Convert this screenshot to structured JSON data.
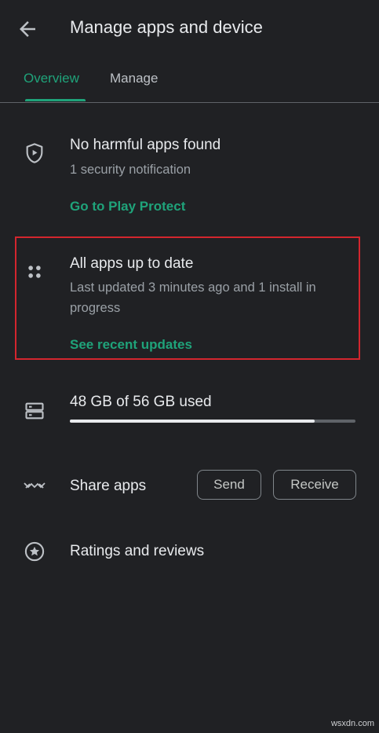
{
  "header": {
    "title": "Manage apps and device",
    "back_icon": "arrow-back-icon"
  },
  "tabs": [
    {
      "label": "Overview",
      "active": true
    },
    {
      "label": "Manage",
      "active": false
    }
  ],
  "protect": {
    "title": "No harmful apps found",
    "subtitle": "1 security notification",
    "link": "Go to Play Protect",
    "icon": "shield-play-icon"
  },
  "updates": {
    "title": "All apps up to date",
    "subtitle_line1": "Last updated 3 minutes ago and 1 install in",
    "subtitle_line2": "progress",
    "link": "See recent updates",
    "icon": "apps-grid-icon"
  },
  "storage": {
    "text": "48 GB of 56 GB used",
    "used_fraction": 0.857,
    "icon": "storage-icon"
  },
  "share": {
    "label": "Share apps",
    "send_label": "Send",
    "receive_label": "Receive",
    "icon": "share-arrows-icon"
  },
  "ratings": {
    "label": "Ratings and reviews",
    "icon": "star-circle-icon"
  },
  "watermark": "wsxdn.com",
  "colors": {
    "background": "#202124",
    "accent": "#1fa37a",
    "highlight_border": "#d3262e"
  }
}
